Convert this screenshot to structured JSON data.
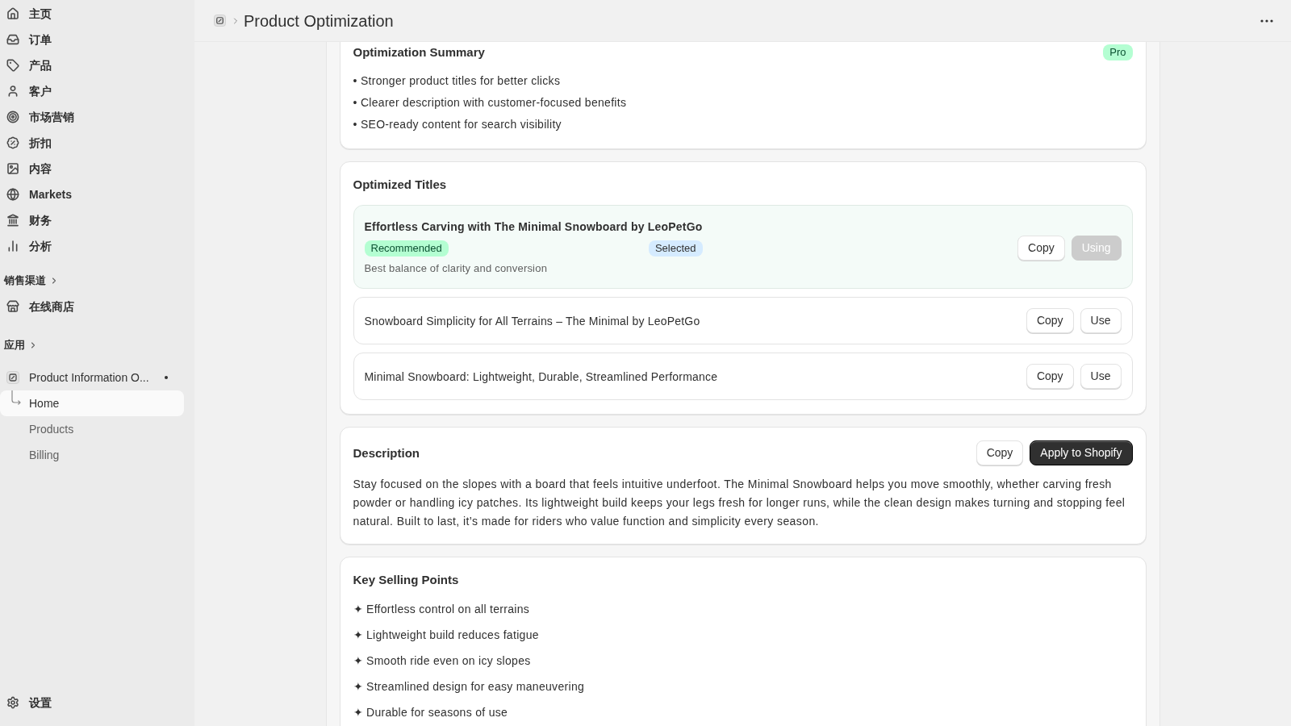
{
  "sidebar": {
    "nav_items": [
      {
        "label": "主页",
        "selected": false
      },
      {
        "label": "订单",
        "selected": false
      },
      {
        "label": "产品",
        "selected": false
      },
      {
        "label": "客户",
        "selected": false
      },
      {
        "label": "市场营销",
        "selected": false
      },
      {
        "label": "折扣",
        "selected": false
      },
      {
        "label": "内容",
        "selected": false
      },
      {
        "label": "Markets",
        "selected": false
      },
      {
        "label": "财务",
        "selected": false
      },
      {
        "label": "分析",
        "selected": false
      }
    ],
    "sales_channels": {
      "heading": "销售渠道",
      "items": [
        {
          "label": "在线商店",
          "selected": false
        }
      ]
    },
    "apps": {
      "heading": "应用",
      "items": [
        {
          "label": "Product Information O...",
          "children": [
            {
              "label": "Home",
              "selected": true
            },
            {
              "label": "Products",
              "selected": false
            },
            {
              "label": "Billing",
              "selected": false
            }
          ]
        }
      ]
    },
    "settings": {
      "label": "设置"
    }
  },
  "header": {
    "title": "Product Optimization"
  },
  "summary": {
    "title": "Optimization Summary",
    "badge": "Pro",
    "points": [
      "• Stronger product titles for better clicks",
      "• Clearer description with customer-focused benefits",
      "• SEO-ready content for search visibility"
    ]
  },
  "optimized_titles": {
    "title": "Optimized Titles",
    "options": [
      {
        "text": "Effortless Carving with The Minimal Snowboard by LeoPetGo",
        "selected": true,
        "badges": [
          {
            "label": "Recommended",
            "kind": "recommended"
          },
          {
            "label": "Selected",
            "kind": "selected"
          }
        ],
        "note": "Best balance of clarity and conversion",
        "actions": [
          {
            "label": "Copy",
            "kind": "copy",
            "disabled": false
          },
          {
            "label": "Using",
            "kind": "use",
            "disabled": true
          }
        ]
      },
      {
        "text": "Snowboard Simplicity for All Terrains – The Minimal by LeoPetGo",
        "selected": false,
        "actions": [
          {
            "label": "Copy",
            "kind": "copy",
            "disabled": false
          },
          {
            "label": "Use",
            "kind": "use",
            "disabled": false
          }
        ]
      },
      {
        "text": "Minimal Snowboard: Lightweight, Durable, Streamlined Performance",
        "selected": false,
        "actions": [
          {
            "label": "Copy",
            "kind": "copy",
            "disabled": false
          },
          {
            "label": "Use",
            "kind": "use",
            "disabled": false
          }
        ]
      }
    ]
  },
  "description": {
    "title": "Description",
    "actions": [
      {
        "label": "Copy",
        "kind": "copy",
        "disabled": false
      },
      {
        "label": "Apply to Shopify",
        "kind": "apply",
        "disabled": false
      }
    ],
    "text": "Stay focused on the slopes with a board that feels intuitive underfoot. The Minimal Snowboard helps you move smoothly, whether carving fresh powder or handling icy patches. Its lightweight build keeps your legs fresh for longer runs, while the clean design makes turning and stopping feel natural. Built to last, it’s made for riders who value function and simplicity every season."
  },
  "key_selling_points": {
    "title": "Key Selling Points",
    "points": [
      "✦ Effortless control on all terrains",
      "✦ Lightweight build reduces fatigue",
      "✦ Smooth ride even on icy slopes",
      "✦ Streamlined design for easy maneuvering",
      "✦ Durable for seasons of use"
    ]
  }
}
